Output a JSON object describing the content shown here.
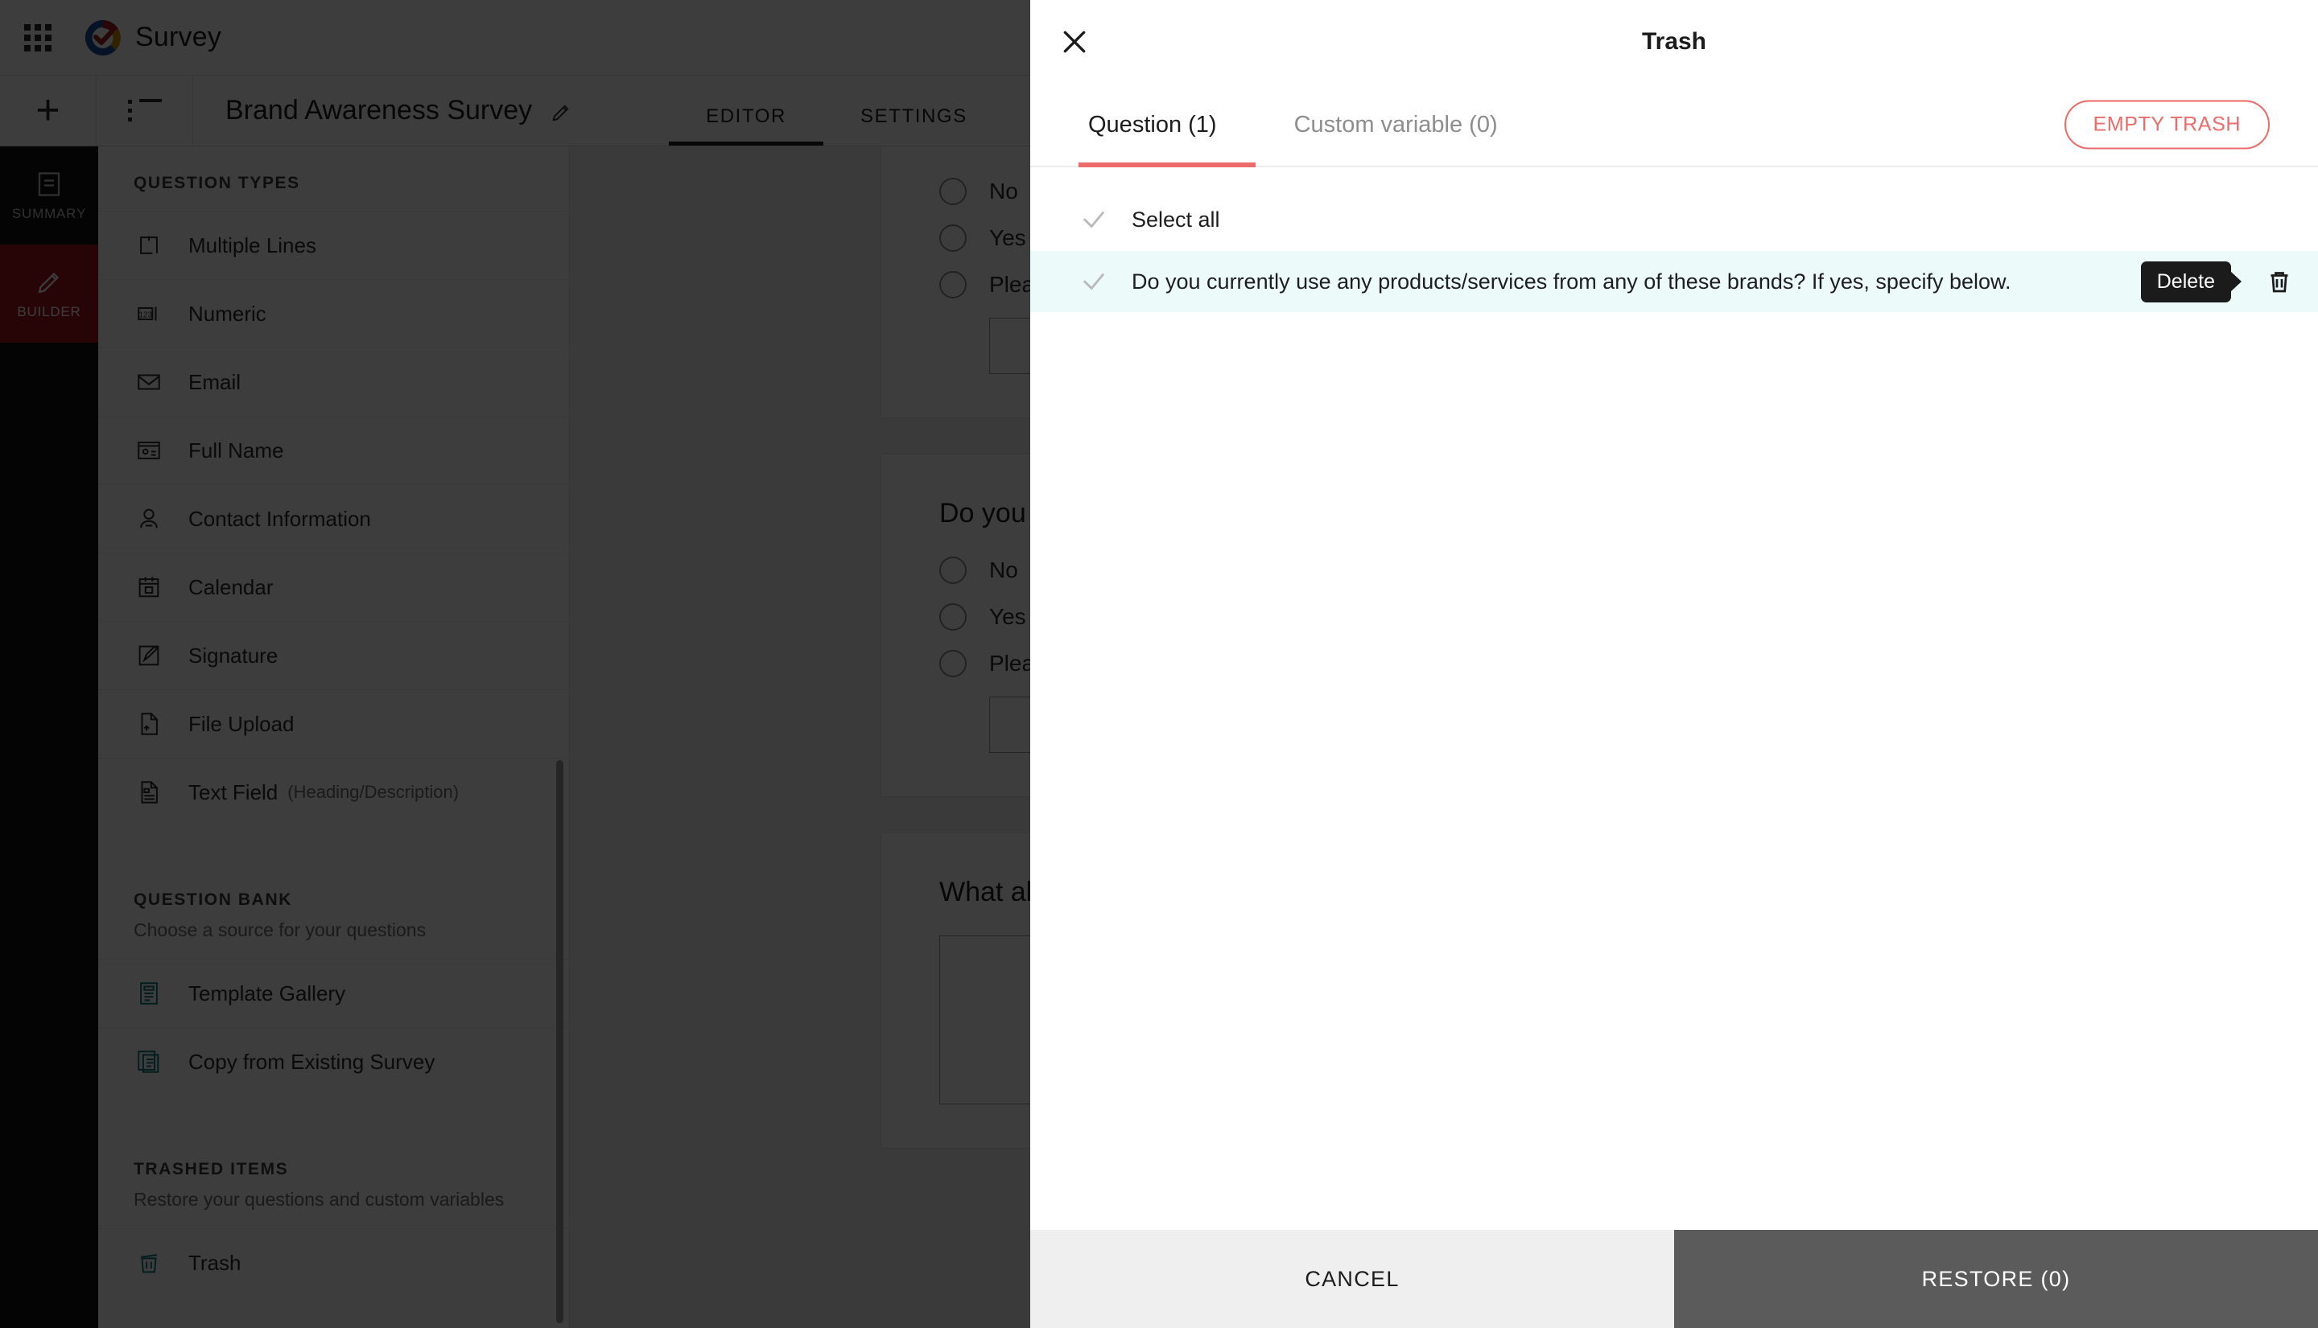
{
  "app": {
    "brand": "Survey",
    "survey_title": "Brand Awareness Survey",
    "header_tabs": [
      {
        "label": "EDITOR",
        "active": true
      },
      {
        "label": "SETTINGS",
        "active": false
      }
    ],
    "rail": [
      {
        "label": "SUMMARY",
        "icon": "summary-icon",
        "active": false
      },
      {
        "label": "BUILDER",
        "icon": "pencil-icon",
        "active": true
      }
    ]
  },
  "sidebar": {
    "question_types_title": "QUESTION TYPES",
    "question_types": [
      {
        "label": "Multiple Lines",
        "icon": "multiple-lines-icon"
      },
      {
        "label": "Numeric",
        "icon": "numeric-icon"
      },
      {
        "label": "Email",
        "icon": "email-icon"
      },
      {
        "label": "Full Name",
        "icon": "full-name-icon"
      },
      {
        "label": "Contact Information",
        "icon": "contact-information-icon"
      },
      {
        "label": "Calendar",
        "icon": "calendar-icon"
      },
      {
        "label": "Signature",
        "icon": "signature-icon"
      },
      {
        "label": "File Upload",
        "icon": "file-upload-icon"
      },
      {
        "label": "Text Field",
        "sub": "(Heading/Description)",
        "icon": "text-field-icon"
      }
    ],
    "question_bank_title": "QUESTION BANK",
    "question_bank_sub": "Choose a source for your questions",
    "question_bank": [
      {
        "label": "Template Gallery",
        "icon": "template-gallery-icon"
      },
      {
        "label": "Copy from Existing Survey",
        "icon": "copy-survey-icon"
      }
    ],
    "trashed_title": "TRASHED ITEMS",
    "trashed_sub": "Restore your questions and custom variables",
    "trashed": [
      {
        "label": "Trash",
        "icon": "trash-icon"
      }
    ]
  },
  "canvas": {
    "cards": [
      {
        "title": "",
        "options": [
          "No",
          "Yes",
          "Please specify"
        ],
        "has_text_input": true
      },
      {
        "title": "Do you currently use",
        "options": [
          "No",
          "Yes",
          "Please specify belo"
        ],
        "has_text_input": true
      },
      {
        "title": "What about that b",
        "options": [],
        "has_box_input": true
      }
    ]
  },
  "modal": {
    "title": "Trash",
    "close_icon": "close-icon",
    "tabs": [
      {
        "label": "Question (1)",
        "active": true
      },
      {
        "label": "Custom variable (0)",
        "active": false
      }
    ],
    "empty_trash_label": "EMPTY TRASH",
    "select_all_label": "Select all",
    "rows": [
      {
        "label": "Do you currently use any products/services from any of these brands? If yes, specify below.",
        "tooltip": "Delete",
        "selected": false
      }
    ],
    "cancel_label": "CANCEL",
    "restore_label": "RESTORE (0)"
  },
  "colors": {
    "accent_red": "#ee6b6b",
    "builder_red": "#a5111a",
    "row_highlight": "#edfafa",
    "teal_icon": "#0d7a80",
    "restore_disabled": "#5b5b5b"
  }
}
